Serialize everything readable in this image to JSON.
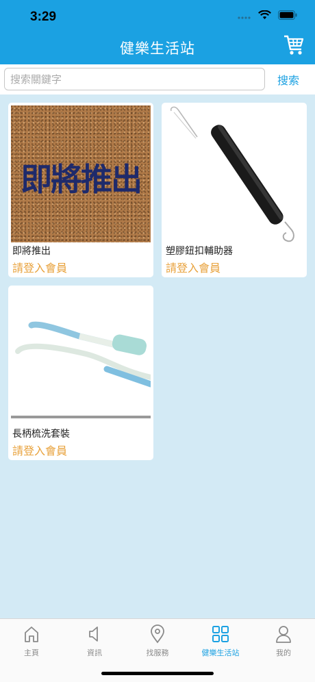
{
  "status": {
    "time": "3:29"
  },
  "header": {
    "title": "健樂生活站"
  },
  "search": {
    "placeholder": "搜索關鍵字",
    "value": "",
    "button_label": "搜索"
  },
  "products": [
    {
      "image_text": "即將推出",
      "name": "即將推出",
      "price_label": "請登入會員"
    },
    {
      "name": "塑膠鈕扣輔助器",
      "price_label": "請登入會員"
    },
    {
      "name": "長柄梳洗套裝",
      "price_label": "請登入會員"
    }
  ],
  "tabs": [
    {
      "label": "主頁",
      "icon": "home-icon"
    },
    {
      "label": "資訊",
      "icon": "speaker-icon"
    },
    {
      "label": "找服務",
      "icon": "location-pin-icon"
    },
    {
      "label": "健樂生活站",
      "icon": "grid-icon",
      "active": true
    },
    {
      "label": "我的",
      "icon": "user-icon"
    }
  ],
  "colors": {
    "brand": "#1ba1e2",
    "background": "#d3eaf5",
    "price": "#e8a23c"
  }
}
